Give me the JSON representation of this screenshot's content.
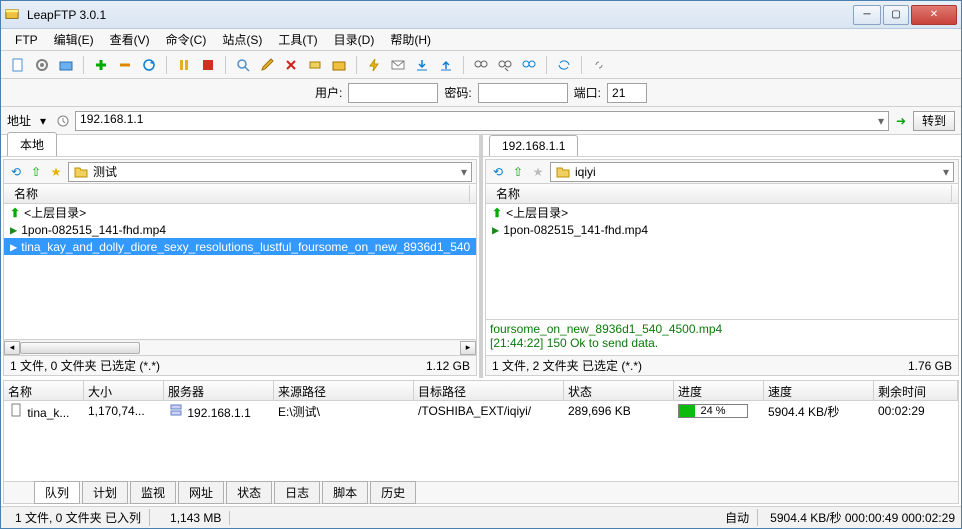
{
  "app": {
    "title": "LeapFTP 3.0.1"
  },
  "menu": {
    "ftp": "FTP",
    "edit": "编辑(E)",
    "view": "查看(V)",
    "command": "命令(C)",
    "sites": "站点(S)",
    "tools": "工具(T)",
    "directory": "目录(D)",
    "help": "帮助(H)"
  },
  "cred": {
    "user_label": "用户:",
    "pass_label": "密码:",
    "port_label": "端口:",
    "port_value": "21"
  },
  "address": {
    "label": "地址",
    "value": "192.168.1.1",
    "go": "转到"
  },
  "local": {
    "tab": "本地",
    "path": "测试",
    "col_name": "名称",
    "up": "<上层目录>",
    "files": [
      "1pon-082515_141-fhd.mp4",
      "tina_kay_and_dolly_diore_sexy_resolutions_lustful_foursome_on_new_8936d1_540"
    ],
    "status_left": "1 文件, 0 文件夹  已选定 (*.*)",
    "status_right": "1.12 GB"
  },
  "remote": {
    "tab": "192.168.1.1",
    "path": "iqiyi",
    "col_name": "名称",
    "up": "<上层目录>",
    "files": [
      "1pon-082515_141-fhd.mp4"
    ],
    "log_line1": "foursome_on_new_8936d1_540_4500.mp4",
    "log_line2": "[21:44:22] 150 Ok to send data.",
    "status_left": "1 文件, 2 文件夹  已选定 (*.*)",
    "status_right": "1.76 GB"
  },
  "transfer": {
    "headers": {
      "name": "名称",
      "size": "大小",
      "server": "服务器",
      "src": "来源路径",
      "dst": "目标路径",
      "status": "状态",
      "progress": "进度",
      "speed": "速度",
      "remain": "剩余时间"
    },
    "rows": [
      {
        "name": "tina_k...",
        "size": "1,170,74...",
        "server": "192.168.1.1",
        "src": "E:\\测试\\",
        "dst": "/TOSHIBA_EXT/iqiyi/",
        "status": "289,696 KB",
        "progress_pct": 24,
        "progress_text": "24 %",
        "speed": "5904.4 KB/秒",
        "remain": "00:02:29"
      }
    ],
    "tabs": {
      "queue": "队列",
      "plan": "计划",
      "monitor": "监视",
      "url": "网址",
      "status": "状态",
      "log": "日志",
      "script": "脚本",
      "history": "历史"
    }
  },
  "statusbar": {
    "left": "1 文件, 0 文件夹  已入列",
    "size": "1,143 MB",
    "auto": "自动",
    "speed": "5904.4 KB/秒 000:00:49 000:02:29"
  }
}
